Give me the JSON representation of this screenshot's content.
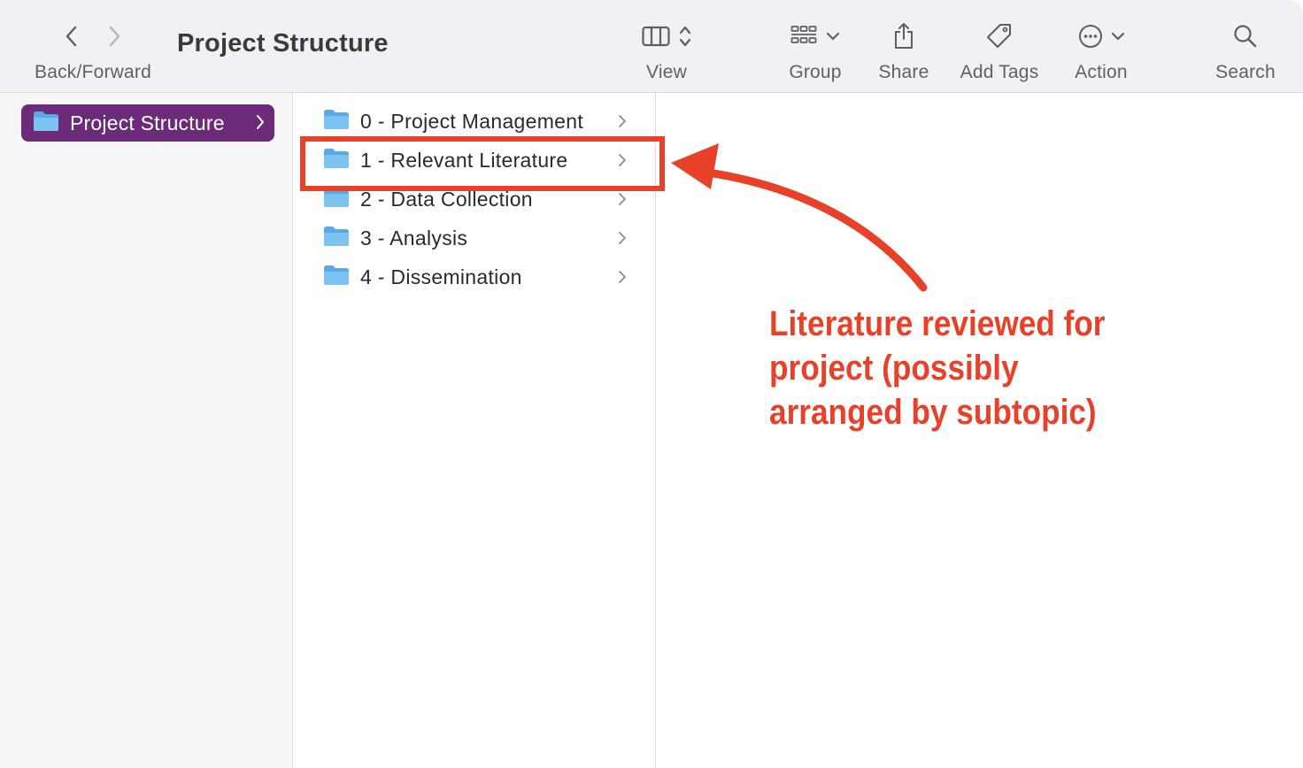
{
  "toolbar": {
    "back_forward_label": "Back/Forward",
    "window_title": "Project Structure",
    "view_label": "View",
    "group_label": "Group",
    "share_label": "Share",
    "add_tags_label": "Add Tags",
    "action_label": "Action",
    "search_label": "Search"
  },
  "sidebar": {
    "items": [
      {
        "label": "Project Structure",
        "icon": "folder-icon",
        "selected": true
      }
    ]
  },
  "column": {
    "items": [
      {
        "label": "0 - Project Management",
        "icon": "folder-icon"
      },
      {
        "label": "1 - Relevant Literature",
        "icon": "folder-icon",
        "highlighted": true
      },
      {
        "label": "2 - Data Collection",
        "icon": "folder-icon"
      },
      {
        "label": "3 - Analysis",
        "icon": "folder-icon"
      },
      {
        "label": "4 - Dissemination",
        "icon": "folder-icon"
      }
    ]
  },
  "annotation": {
    "lines": [
      "Literature reviewed for",
      "project (possibly",
      "arranged by subtopic)"
    ]
  },
  "colors": {
    "accent": "#6c2b78",
    "annotation": "#e8412a",
    "folder": "#7cc3f2",
    "toolbar_bg": "#f2f0f4"
  }
}
